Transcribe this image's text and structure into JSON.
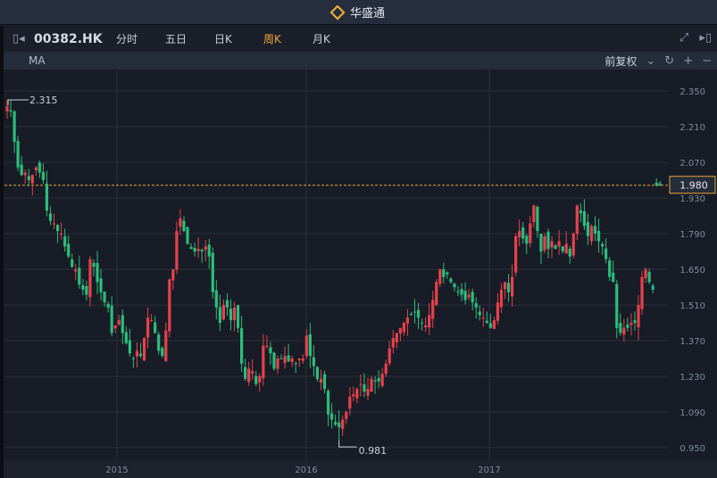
{
  "app": {
    "title": "华盛通",
    "logo_icon": "diamond-logo-icon"
  },
  "toolbar": {
    "symbol": "00382.HK",
    "periods": [
      "分时",
      "五日",
      "日K",
      "周K",
      "月K"
    ],
    "active_period": "周K"
  },
  "indicator": {
    "label": "MA",
    "adjust": "前复权"
  },
  "colors": {
    "up": "#e5424d",
    "down": "#2bbd7c",
    "current_line": "#e9a33a"
  },
  "chart_data": {
    "type": "candlestick",
    "interval": "weekly",
    "yticks": [
      "2.350",
      "2.210",
      "2.070",
      "1.930",
      "1.790",
      "1.650",
      "1.510",
      "1.370",
      "1.230",
      "1.090",
      "0.950"
    ],
    "ylim": [
      0.95,
      2.35
    ],
    "xticks": [
      "2015",
      "2016",
      "2017"
    ],
    "max_label": "2.315",
    "max_value": 2.315,
    "min_label": "0.981",
    "min_value": 0.981,
    "current_price_label": "1.980",
    "current_price": 1.98,
    "closes": [
      2.29,
      2.27,
      2.15,
      2.05,
      2.02,
      2.03,
      2.0,
      2.02,
      2.05,
      2.03,
      2.0,
      1.88,
      1.84,
      1.83,
      1.8,
      1.79,
      1.74,
      1.7,
      1.66,
      1.65,
      1.59,
      1.57,
      1.55,
      1.69,
      1.66,
      1.6,
      1.56,
      1.52,
      1.5,
      1.4,
      1.43,
      1.45,
      1.4,
      1.36,
      1.32,
      1.3,
      1.33,
      1.31,
      1.38,
      1.46,
      1.45,
      1.4,
      1.33,
      1.31,
      1.41,
      1.61,
      1.65,
      1.8,
      1.85,
      1.8,
      1.75,
      1.73,
      1.72,
      1.73,
      1.72,
      1.74,
      1.7,
      1.56,
      1.5,
      1.44,
      1.51,
      1.5,
      1.45,
      1.5,
      1.42,
      1.28,
      1.22,
      1.26,
      1.25,
      1.2,
      1.23,
      1.35,
      1.35,
      1.32,
      1.26,
      1.3,
      1.3,
      1.31,
      1.29,
      1.3,
      1.28,
      1.3,
      1.3,
      1.39,
      1.31,
      1.27,
      1.22,
      1.22,
      1.18,
      1.08,
      1.06,
      1.04,
      1.03,
      1.06,
      1.09,
      1.15,
      1.16,
      1.18,
      1.2,
      1.17,
      1.18,
      1.22,
      1.21,
      1.21,
      1.24,
      1.28,
      1.34,
      1.38,
      1.4,
      1.42,
      1.44,
      1.46,
      1.47,
      1.48,
      1.46,
      1.44,
      1.43,
      1.47,
      1.53,
      1.6,
      1.65,
      1.62,
      1.63,
      1.6,
      1.58,
      1.56,
      1.55,
      1.53,
      1.55,
      1.52,
      1.5,
      1.47,
      1.46,
      1.44,
      1.42,
      1.45,
      1.52,
      1.57,
      1.6,
      1.56,
      1.62,
      1.78,
      1.8,
      1.77,
      1.75,
      1.83,
      1.9,
      1.8,
      1.72,
      1.78,
      1.73,
      1.76,
      1.73,
      1.76,
      1.72,
      1.75,
      1.7,
      1.79,
      1.9,
      1.87,
      1.82,
      1.78,
      1.82,
      1.79,
      1.76,
      1.74,
      1.69,
      1.62,
      1.6,
      1.42,
      1.4,
      1.42,
      1.42,
      1.44,
      1.44,
      1.51,
      1.62,
      1.65,
      1.6,
      1.57,
      1.98,
      1.98
    ]
  }
}
